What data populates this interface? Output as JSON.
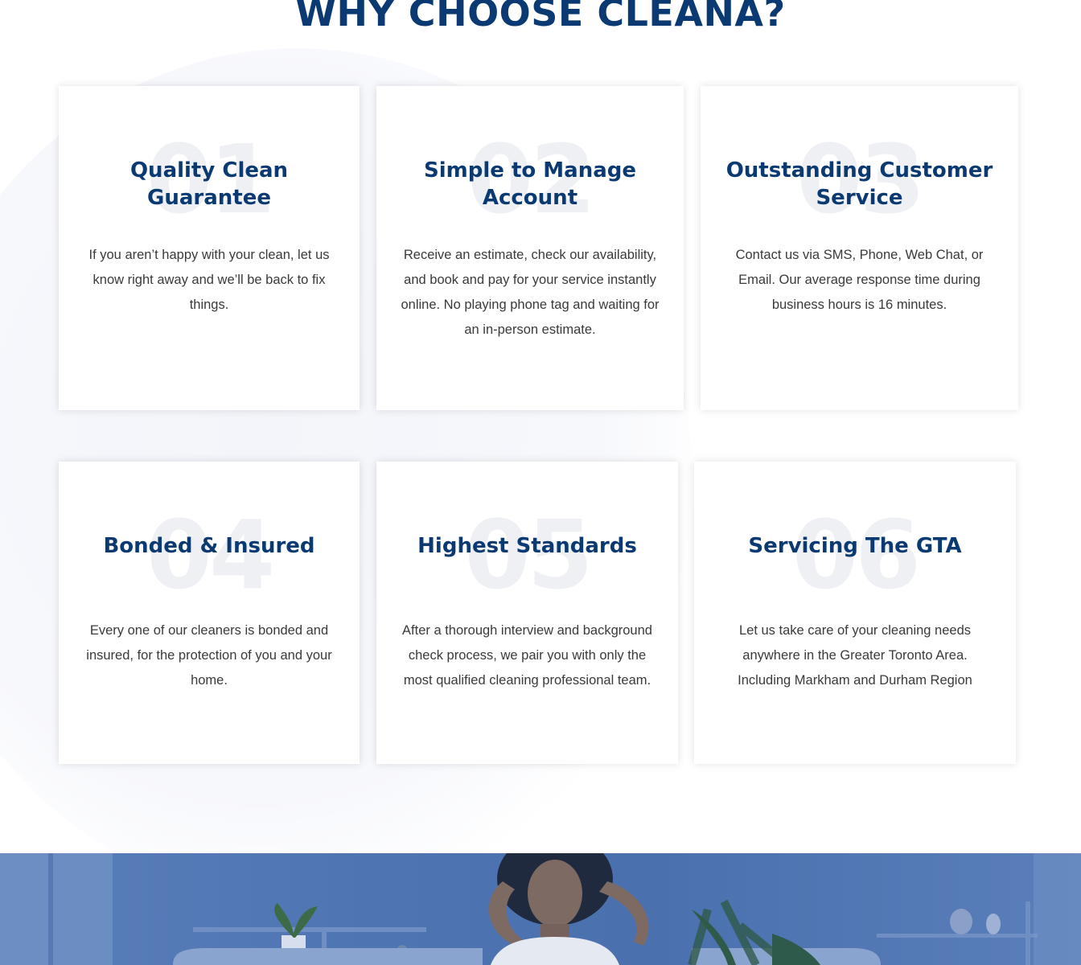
{
  "section": {
    "heading": "WHY CHOOSE CLEANA?"
  },
  "features": [
    {
      "number": "01",
      "title": "Quality Clean Guarantee",
      "description": "If you aren’t happy with your clean, let us know right away and we’ll be back to fix things."
    },
    {
      "number": "02",
      "title": "Simple to Manage Account",
      "description": "Receive an estimate, check our availability, and book and pay for your service instantly online. No playing phone tag and waiting for an in-person estimate."
    },
    {
      "number": "03",
      "title": "Outstanding Customer Service",
      "description": "Contact us via SMS, Phone, Web Chat, or Email. Our average response time during business hours is 16 minutes."
    },
    {
      "number": "04",
      "title": "Bonded & Insured",
      "description": "Every one of our cleaners is bonded and insured, for the protection of you and your home."
    },
    {
      "number": "05",
      "title": "Highest Standards",
      "description": "After a thorough interview and background check process, we pair you with only the most qualified cleaning professional team."
    },
    {
      "number": "06",
      "title": "Servicing The GTA",
      "description": "Let us take care of your cleaning needs anywhere in the Greater Toronto Area. Including Markham and Durham Region"
    }
  ],
  "colors": {
    "heading": "#0b3a73",
    "hero_overlay": "#4e74b2"
  }
}
